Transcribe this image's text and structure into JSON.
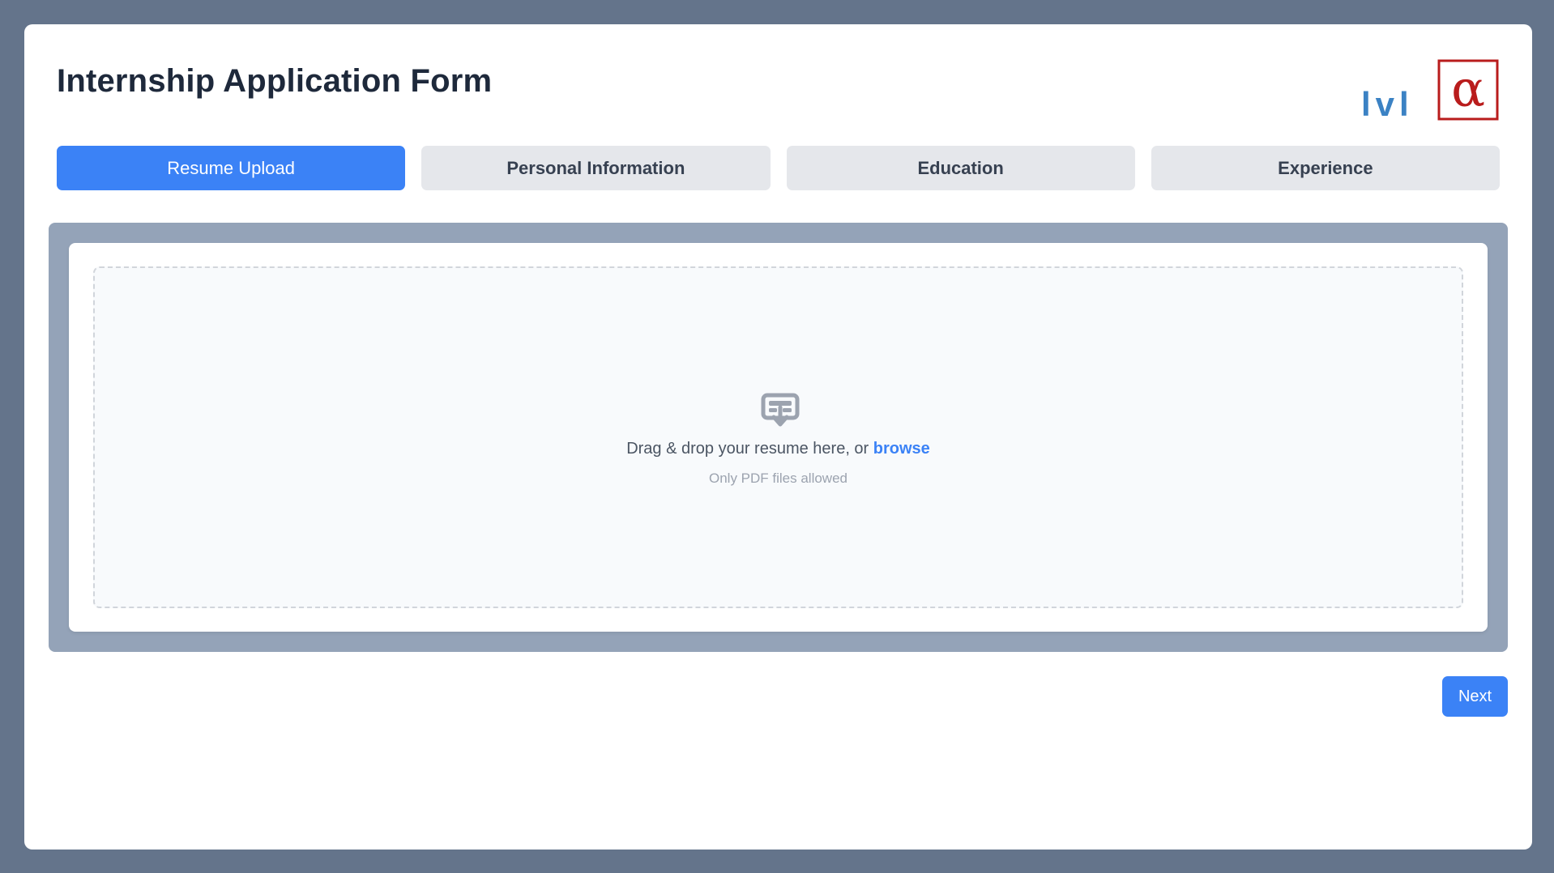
{
  "form": {
    "title": "Internship Application Form"
  },
  "logo": {
    "text": "lvl",
    "symbol": "α",
    "text_color": "#3b82c4",
    "symbol_color": "#b91c1c"
  },
  "tabs": [
    {
      "label": "Resume Upload",
      "active": true
    },
    {
      "label": "Personal Information",
      "active": false
    },
    {
      "label": "Education",
      "active": false
    },
    {
      "label": "Experience",
      "active": false
    }
  ],
  "upload": {
    "icon": "upload-icon",
    "prompt": "Drag & drop your resume here, or",
    "browse_label": "browse",
    "hint": "Only PDF files allowed"
  },
  "actions": {
    "next_label": "Next"
  },
  "colors": {
    "page_background": "#64748b",
    "accent": "#3b82f6",
    "tab_inactive": "#e5e7eb",
    "panel_frame": "#94a3b8"
  }
}
